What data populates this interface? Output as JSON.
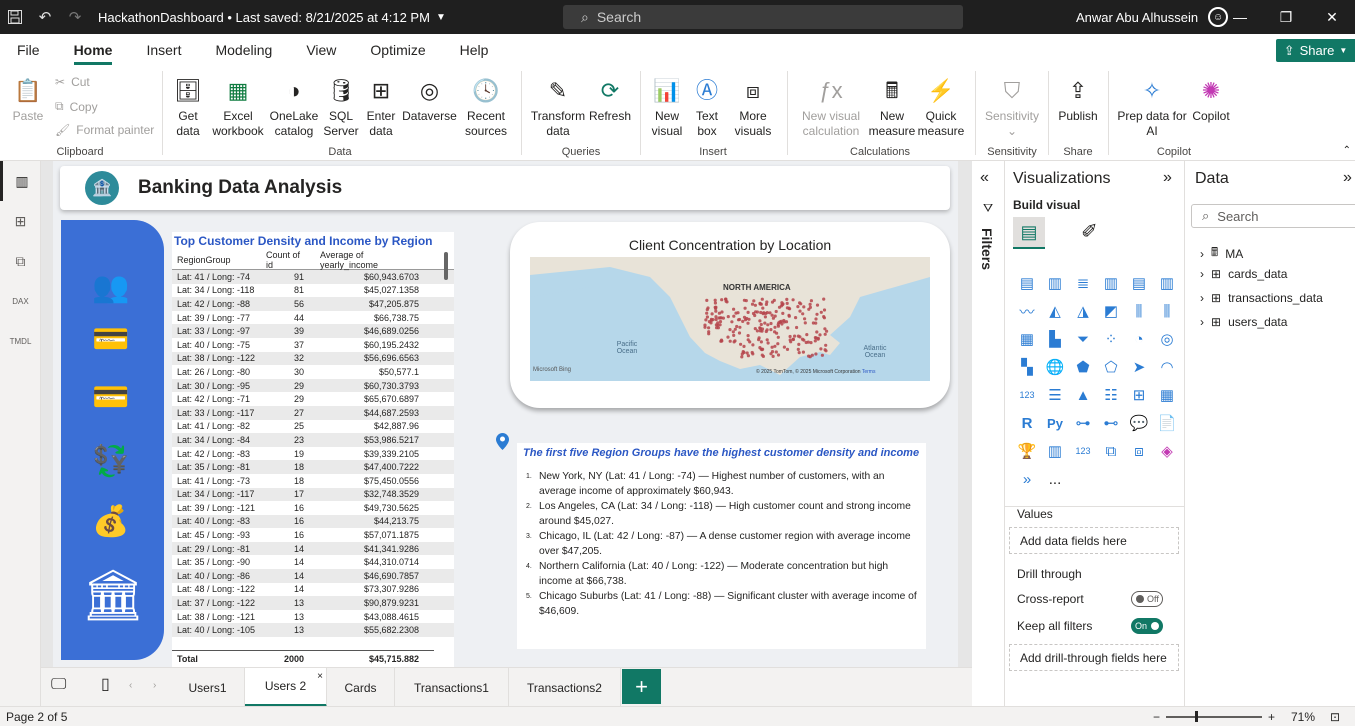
{
  "titlebar": {
    "file_title": "HackathonDashboard • Last saved: 8/21/2025 at 4:12 PM",
    "search_placeholder": "Search",
    "user_name": "Anwar Abu Alhussein"
  },
  "menu": [
    "File",
    "Home",
    "Insert",
    "Modeling",
    "View",
    "Optimize",
    "Help"
  ],
  "share_label": "Share",
  "ribbon": {
    "clipboard": {
      "paste": "Paste",
      "cut": "Cut",
      "copy": "Copy",
      "format_painter": "Format painter",
      "group": "Clipboard"
    },
    "data": {
      "get_data": "Get data",
      "excel": "Excel workbook",
      "onelake": "OneLake catalog",
      "sql": "SQL Server",
      "enter": "Enter data",
      "dataverse": "Dataverse",
      "recent": "Recent sources",
      "group": "Data"
    },
    "queries": {
      "transform": "Transform data",
      "refresh": "Refresh",
      "group": "Queries"
    },
    "insert": {
      "new_visual": "New visual",
      "text_box": "Text box",
      "more_visuals": "More visuals",
      "group": "Insert"
    },
    "calculations": {
      "new_visual_calc": "New visual calculation",
      "new_measure": "New measure",
      "quick_measure": "Quick measure",
      "group": "Calculations"
    },
    "sensitivity": {
      "label": "Sensitivity",
      "group": "Sensitivity"
    },
    "share": {
      "publish": "Publish",
      "group": "Share"
    },
    "copilot": {
      "prep": "Prep data for AI",
      "copilot": "Copilot",
      "group": "Copilot"
    }
  },
  "report": {
    "title": "Banking Data Analysis",
    "table": {
      "title": "Top Customer Density and Income by Region",
      "headers": [
        "RegionGroup",
        "Count of id",
        "Average of yearly_income"
      ],
      "rows": [
        [
          "Lat: 41 / Long: -74",
          "91",
          "$60,943.6703"
        ],
        [
          "Lat: 34 / Long: -118",
          "81",
          "$45,027.1358"
        ],
        [
          "Lat: 42 / Long: -88",
          "56",
          "$47,205.875"
        ],
        [
          "Lat: 39 / Long: -77",
          "44",
          "$66,738.75"
        ],
        [
          "Lat: 33 / Long: -97",
          "39",
          "$46,689.0256"
        ],
        [
          "Lat: 40 / Long: -75",
          "37",
          "$60,195.2432"
        ],
        [
          "Lat: 38 / Long: -122",
          "32",
          "$56,696.6563"
        ],
        [
          "Lat: 26 / Long: -80",
          "30",
          "$50,577.1"
        ],
        [
          "Lat: 30 / Long: -95",
          "29",
          "$60,730.3793"
        ],
        [
          "Lat: 42 / Long: -71",
          "29",
          "$65,670.6897"
        ],
        [
          "Lat: 33 / Long: -117",
          "27",
          "$44,687.2593"
        ],
        [
          "Lat: 41 / Long: -82",
          "25",
          "$42,887.96"
        ],
        [
          "Lat: 34 / Long: -84",
          "23",
          "$53,986.5217"
        ],
        [
          "Lat: 42 / Long: -83",
          "19",
          "$39,339.2105"
        ],
        [
          "Lat: 35 / Long: -81",
          "18",
          "$47,400.7222"
        ],
        [
          "Lat: 41 / Long: -73",
          "18",
          "$75,450.0556"
        ],
        [
          "Lat: 34 / Long: -117",
          "17",
          "$32,748.3529"
        ],
        [
          "Lat: 39 / Long: -121",
          "16",
          "$49,730.5625"
        ],
        [
          "Lat: 40 / Long: -83",
          "16",
          "$44,213.75"
        ],
        [
          "Lat: 45 / Long: -93",
          "16",
          "$57,071.1875"
        ],
        [
          "Lat: 29 / Long: -81",
          "14",
          "$41,341.9286"
        ],
        [
          "Lat: 35 / Long: -90",
          "14",
          "$44,310.0714"
        ],
        [
          "Lat: 40 / Long: -86",
          "14",
          "$46,690.7857"
        ],
        [
          "Lat: 48 / Long: -122",
          "14",
          "$73,307.9286"
        ],
        [
          "Lat: 37 / Long: -122",
          "13",
          "$90,879.9231"
        ],
        [
          "Lat: 38 / Long: -121",
          "13",
          "$43,088.4615"
        ],
        [
          "Lat: 40 / Long: -105",
          "13",
          "$55,682.2308"
        ]
      ],
      "total": [
        "Total",
        "2000",
        "$45,715.882"
      ]
    },
    "map": {
      "title": "Client Concentration by Location",
      "label_continent": "NORTH AMERICA",
      "label_pacific": "Pacific Ocean",
      "label_atlantic": "Atlantic Ocean",
      "bing": "Microsoft Bing",
      "copyright": "© 2025 TomTom, © 2025 Microsoft Corporation",
      "terms": "Terms"
    },
    "insight": {
      "title": "The first five Region Groups have the highest customer density and income",
      "items": [
        "New York, NY (Lat: 41 / Long: -74) — Highest number of customers, with an average income of approximately $60,943.",
        "Los Angeles, CA (Lat: 34 / Long: -118) — High customer count and strong income around $45,027.",
        "Chicago, IL (Lat: 42 / Long: -87) — A dense customer region with average income over $47,205.",
        "Northern California (Lat: 40 / Long: -122) — Moderate concentration but high income at $66,738.",
        "Chicago Suburbs (Lat: 41 / Long: -88) — Significant cluster with average income of $46,609."
      ]
    }
  },
  "filters_label": "Filters",
  "viz_pane": {
    "title": "Visualizations",
    "build_visual": "Build visual",
    "values": "Values",
    "add_data_fields": "Add data fields here",
    "drill_through": "Drill through",
    "cross_report": "Cross-report",
    "cross_report_state": "Off",
    "keep_all_filters": "Keep all filters",
    "keep_all_filters_state": "On",
    "add_drill_fields": "Add drill-through fields here",
    "more": "..."
  },
  "data_pane": {
    "title": "Data",
    "search_placeholder": "Search",
    "tables": [
      "MA",
      "cards_data",
      "transactions_data",
      "users_data"
    ]
  },
  "tabs": [
    "Users1",
    "Users 2",
    "Cards",
    "Transactions1",
    "Transactions2"
  ],
  "active_tab": "Users 2",
  "status": {
    "page": "Page 2 of 5",
    "zoom": "71%"
  },
  "colors": {
    "accent": "#117865",
    "panel_blue": "#3b6fd6",
    "title_blue": "#2b57c4"
  }
}
